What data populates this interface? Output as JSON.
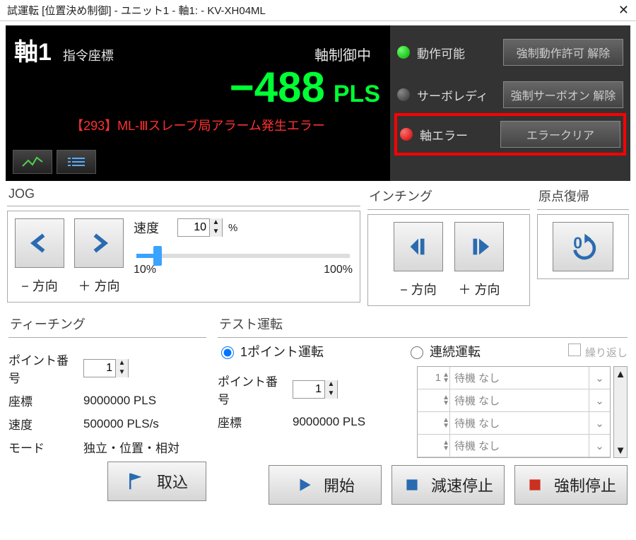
{
  "title": "試運転 [位置決め制御] - ユニット1 - 軸1: - KV-XH04ML",
  "display": {
    "axis": "軸1",
    "cmd_label": "指令座標",
    "ctrl_label": "軸制御中",
    "value": "−488",
    "unit": "PLS",
    "error_line": "【293】ML-Ⅲスレーブ局アラーム発生エラー",
    "status": [
      {
        "id": "op-enable",
        "label": "動作可能",
        "btn": "強制動作許可 解除",
        "led": "green"
      },
      {
        "id": "servo-ready",
        "label": "サーボレディ",
        "btn": "強制サーボオン 解除",
        "led": "grey"
      },
      {
        "id": "axis-error",
        "label": "軸エラー",
        "btn": "エラークリア",
        "led": "red"
      }
    ]
  },
  "jog": {
    "title": "JOG",
    "neg": "− 方向",
    "pos": "＋ 方向",
    "speed_label": "速度",
    "speed_value": "10",
    "speed_unit": "%",
    "min": "10%",
    "max": "100%"
  },
  "inching": {
    "title": "インチング",
    "neg": "− 方向",
    "pos": "＋ 方向"
  },
  "origin": {
    "title": "原点復帰"
  },
  "teach": {
    "title": "ティーチング",
    "point_label": "ポイント番号",
    "point_value": "1",
    "coord_label": "座標",
    "coord_value": "9000000 PLS",
    "speed_label": "速度",
    "speed_value": "500000 PLS/s",
    "mode_label": "モード",
    "mode_value": "独立・位置・相対",
    "get_btn": "取込"
  },
  "test": {
    "title": "テスト運転",
    "radio1": "1ポイント運転",
    "radio2": "連続運転",
    "repeat": "繰り返し",
    "point_label": "ポイント番号",
    "point_value": "1",
    "coord_label": "座標",
    "coord_value": "9000000 PLS",
    "list": [
      {
        "n": "1",
        "t": "待機 なし"
      },
      {
        "n": "",
        "t": "待機 なし"
      },
      {
        "n": "",
        "t": "待機 なし"
      },
      {
        "n": "",
        "t": "待機 なし"
      }
    ]
  },
  "bottom": {
    "start": "開始",
    "decel": "減速停止",
    "force": "強制停止"
  }
}
